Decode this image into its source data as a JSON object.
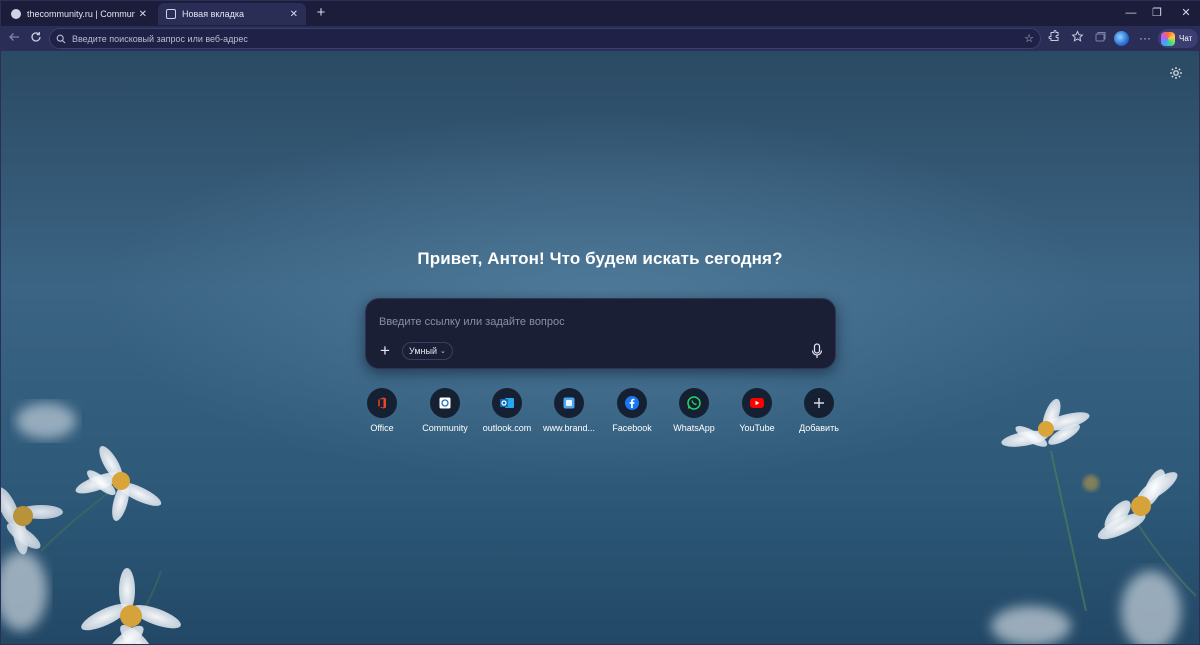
{
  "tabs": [
    {
      "title": "thecommunity.ru | Community",
      "close": "✕"
    },
    {
      "title": "Новая вкладка",
      "close": "✕"
    }
  ],
  "new_tab_symbol": "+",
  "window_controls": {
    "minimize": "—",
    "maximize": "❐",
    "close": "✕"
  },
  "address_bar": {
    "placeholder": "Введите поисковый запрос или веб-адрес",
    "value": ""
  },
  "toolbar": {
    "back_icon": "back-arrow-icon",
    "reload_icon": "reload-icon",
    "favorite_icon": "star-icon",
    "extensions_icon": "extensions-icon",
    "favorites_icon": "favorites-icon",
    "collections_icon": "collections-icon",
    "more_symbol": "···",
    "chat_label": "Чат"
  },
  "greeting": "Привет, Антон! Что будем искать сегодня?",
  "search": {
    "placeholder": "Введите ссылку или задайте вопрос",
    "add_symbol": "+",
    "mode_label": "Умный",
    "mode_chevron": "⌄"
  },
  "quick_links": [
    {
      "label": "Office",
      "icon": "office-icon",
      "color": "#e8482a"
    },
    {
      "label": "Community",
      "icon": "community-icon",
      "color": "#ffffff"
    },
    {
      "label": "outlook.com",
      "icon": "outlook-icon",
      "color": "#1a73d6"
    },
    {
      "label": "www.brand...",
      "icon": "brand-site-icon",
      "color": "#4aa8f0"
    },
    {
      "label": "Facebook",
      "icon": "facebook-icon",
      "color": "#1877f2"
    },
    {
      "label": "WhatsApp",
      "icon": "whatsapp-icon",
      "color": "#25d366"
    },
    {
      "label": "YouTube",
      "icon": "youtube-icon",
      "color": "#ff0000"
    },
    {
      "label": "Добавить",
      "icon": "add-icon",
      "color": "#d8dbe8"
    }
  ],
  "colors": {
    "chrome_bg": "#1b1d3b",
    "toolbar_bg": "#2a2d55",
    "search_box_bg": "#1b1f35"
  }
}
